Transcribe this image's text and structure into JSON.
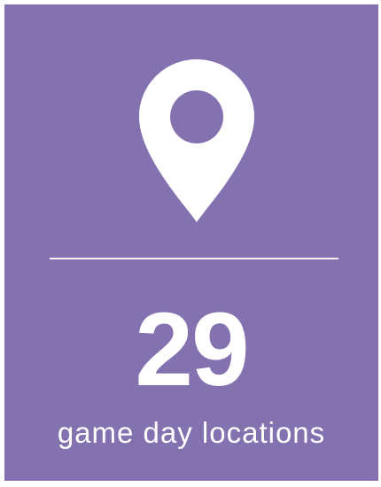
{
  "card": {
    "background_color": "#8471b0",
    "icon": "location-pin-icon",
    "value": "29",
    "label": "game day locations"
  }
}
